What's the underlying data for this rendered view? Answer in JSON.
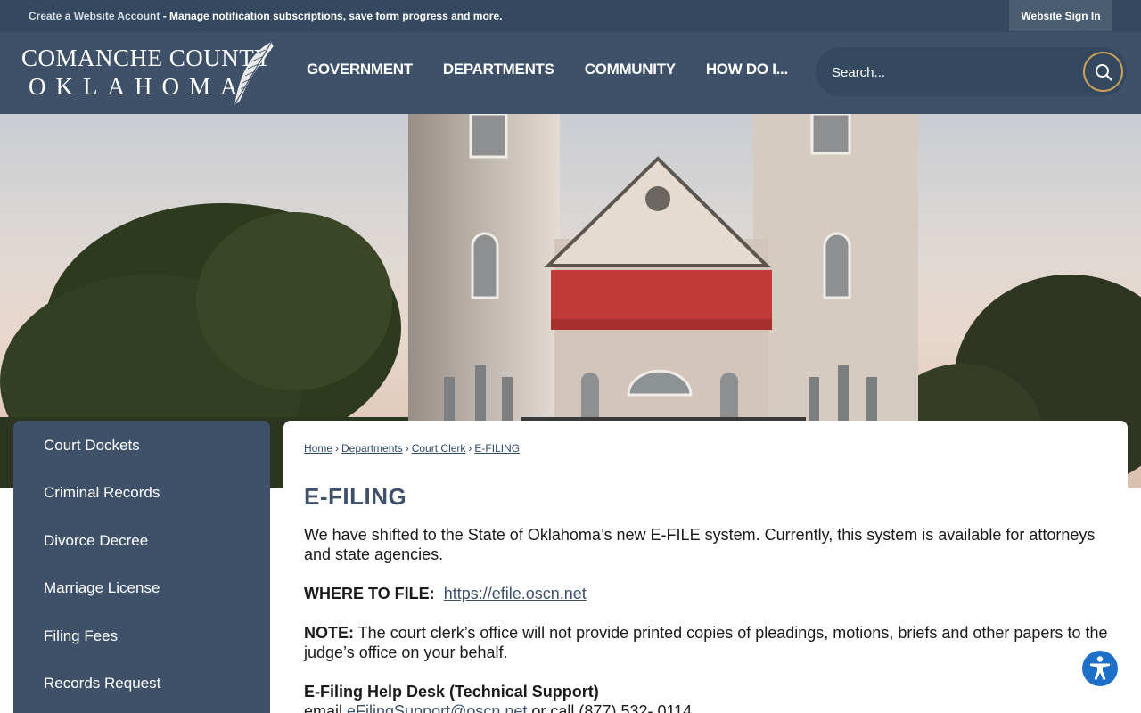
{
  "topbar": {
    "create_account_link": "Create a Website Account",
    "create_account_desc": " - Manage notification subscriptions, save form progress and more.",
    "signin_label": "Website Sign In"
  },
  "header": {
    "logo_line1": "COMANCHE COUNTY",
    "logo_line2": "OKLAHOMA",
    "nav": [
      "GOVERNMENT",
      "DEPARTMENTS",
      "COMMUNITY",
      "HOW DO I..."
    ],
    "search_placeholder": "Search..."
  },
  "sidebar": {
    "items": [
      "Court Dockets",
      "Criminal Records",
      "Divorce Decree",
      "Marriage License",
      "Filing Fees",
      "Records Request"
    ]
  },
  "breadcrumb": [
    "Home",
    "Departments",
    "Court Clerk",
    "E-FILING"
  ],
  "content": {
    "title": "E-FILING",
    "intro": "We have shifted to the State of Oklahoma’s new E-FILE system. Currently, this system is available for attorneys and state agencies.",
    "where_label": "WHERE TO FILE:",
    "where_link": "https://efile.oscn.net",
    "note_label": "NOTE:",
    "note_text": " The court clerk’s office will not provide printed copies of pleadings, motions, briefs and other papers to the judge’s office on your behalf.",
    "helpdesk_title": "E-Filing Help Desk (Technical Support)",
    "helpdesk_email_prefix": "email ",
    "helpdesk_email": "eFilingSupport@oscn.net",
    "helpdesk_phone": " or call (877) 532- 0114"
  },
  "colors": {
    "header_bg": "#3e5169",
    "topbar_bg": "#34495f",
    "accent_gold": "#c9a15a",
    "title_color": "#3e5169"
  }
}
